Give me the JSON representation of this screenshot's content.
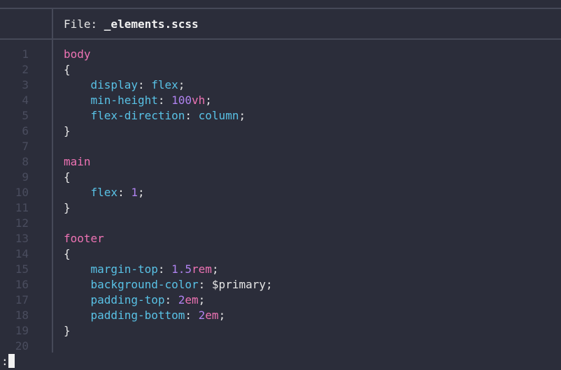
{
  "header": {
    "label": "File: ",
    "filename": "_elements.scss"
  },
  "command_line": {
    "prompt": ":"
  },
  "lines": [
    {
      "n": "1",
      "indent": "",
      "tokens": [
        {
          "c": "sel",
          "t": "body"
        }
      ]
    },
    {
      "n": "2",
      "indent": "",
      "tokens": [
        {
          "c": "brace",
          "t": "{"
        }
      ]
    },
    {
      "n": "3",
      "indent": "    ",
      "tokens": [
        {
          "c": "prop",
          "t": "display"
        },
        {
          "c": "punct",
          "t": ": "
        },
        {
          "c": "val",
          "t": "flex"
        },
        {
          "c": "punct",
          "t": ";"
        }
      ]
    },
    {
      "n": "4",
      "indent": "    ",
      "tokens": [
        {
          "c": "prop",
          "t": "min-height"
        },
        {
          "c": "punct",
          "t": ": "
        },
        {
          "c": "num",
          "t": "100"
        },
        {
          "c": "unit",
          "t": "vh"
        },
        {
          "c": "punct",
          "t": ";"
        }
      ]
    },
    {
      "n": "5",
      "indent": "    ",
      "tokens": [
        {
          "c": "prop",
          "t": "flex-direction"
        },
        {
          "c": "punct",
          "t": ": "
        },
        {
          "c": "val",
          "t": "column"
        },
        {
          "c": "punct",
          "t": ";"
        }
      ]
    },
    {
      "n": "6",
      "indent": "",
      "tokens": [
        {
          "c": "brace",
          "t": "}"
        }
      ]
    },
    {
      "n": "7",
      "indent": "",
      "tokens": []
    },
    {
      "n": "8",
      "indent": "",
      "tokens": [
        {
          "c": "sel",
          "t": "main"
        }
      ]
    },
    {
      "n": "9",
      "indent": "",
      "tokens": [
        {
          "c": "brace",
          "t": "{"
        }
      ]
    },
    {
      "n": "10",
      "indent": "    ",
      "tokens": [
        {
          "c": "prop",
          "t": "flex"
        },
        {
          "c": "punct",
          "t": ": "
        },
        {
          "c": "num",
          "t": "1"
        },
        {
          "c": "punct",
          "t": ";"
        }
      ]
    },
    {
      "n": "11",
      "indent": "",
      "tokens": [
        {
          "c": "brace",
          "t": "}"
        }
      ]
    },
    {
      "n": "12",
      "indent": "",
      "tokens": []
    },
    {
      "n": "13",
      "indent": "",
      "tokens": [
        {
          "c": "sel",
          "t": "footer"
        }
      ]
    },
    {
      "n": "14",
      "indent": "",
      "tokens": [
        {
          "c": "brace",
          "t": "{"
        }
      ]
    },
    {
      "n": "15",
      "indent": "    ",
      "tokens": [
        {
          "c": "prop",
          "t": "margin-top"
        },
        {
          "c": "punct",
          "t": ": "
        },
        {
          "c": "num",
          "t": "1.5"
        },
        {
          "c": "unit",
          "t": "rem"
        },
        {
          "c": "punct",
          "t": ";"
        }
      ]
    },
    {
      "n": "16",
      "indent": "    ",
      "tokens": [
        {
          "c": "prop",
          "t": "background-color"
        },
        {
          "c": "punct",
          "t": ": "
        },
        {
          "c": "var",
          "t": "$primary"
        },
        {
          "c": "punct",
          "t": ";"
        }
      ]
    },
    {
      "n": "17",
      "indent": "    ",
      "tokens": [
        {
          "c": "prop",
          "t": "padding-top"
        },
        {
          "c": "punct",
          "t": ": "
        },
        {
          "c": "num",
          "t": "2"
        },
        {
          "c": "unit",
          "t": "em"
        },
        {
          "c": "punct",
          "t": ";"
        }
      ]
    },
    {
      "n": "18",
      "indent": "    ",
      "tokens": [
        {
          "c": "prop",
          "t": "padding-bottom"
        },
        {
          "c": "punct",
          "t": ": "
        },
        {
          "c": "num",
          "t": "2"
        },
        {
          "c": "unit",
          "t": "em"
        },
        {
          "c": "punct",
          "t": ";"
        }
      ]
    },
    {
      "n": "19",
      "indent": "",
      "tokens": [
        {
          "c": "brace",
          "t": "}"
        }
      ]
    },
    {
      "n": "20",
      "indent": "",
      "tokens": []
    }
  ]
}
